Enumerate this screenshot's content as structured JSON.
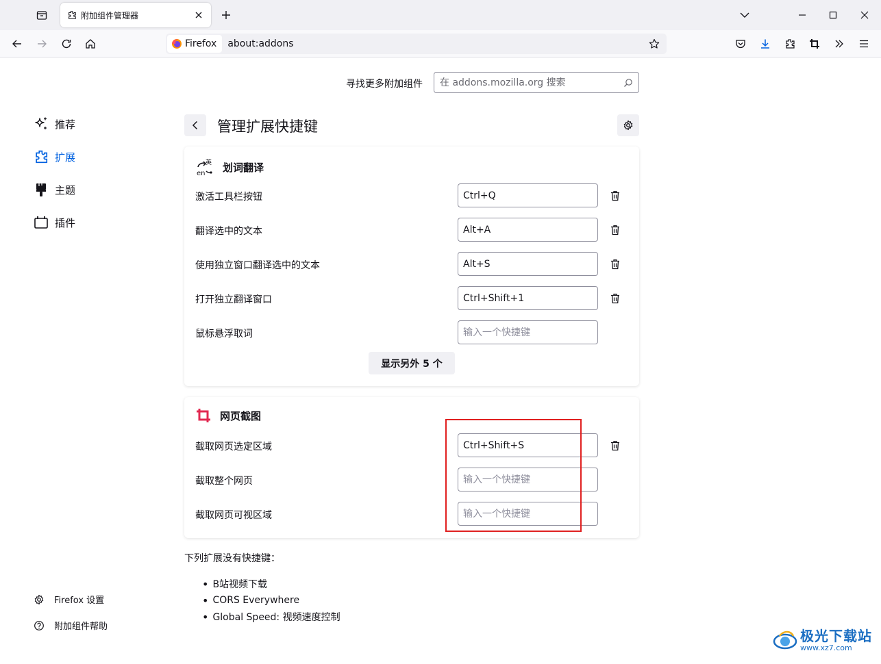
{
  "browser": {
    "tab_title": "附加组件管理器",
    "identity_label": "Firefox",
    "url": "about:addons"
  },
  "search": {
    "label": "寻找更多附加组件",
    "placeholder": "在 addons.mozilla.org 搜索"
  },
  "sidebar": {
    "items": [
      {
        "label": "推荐",
        "icon": "sparkle-icon"
      },
      {
        "label": "扩展",
        "icon": "puzzle-icon",
        "active": true
      },
      {
        "label": "主题",
        "icon": "brush-icon"
      },
      {
        "label": "插件",
        "icon": "plugin-icon"
      }
    ],
    "footer": [
      {
        "label": "Firefox 设置",
        "icon": "gear-icon"
      },
      {
        "label": "附加组件帮助",
        "icon": "help-icon"
      }
    ]
  },
  "page": {
    "title": "管理扩展快捷键"
  },
  "extensions": [
    {
      "name": "划词翻译",
      "shortcuts": [
        {
          "label": "激活工具栏按钮",
          "value": "Ctrl+Q"
        },
        {
          "label": "翻译选中的文本",
          "value": "Alt+A"
        },
        {
          "label": "使用独立窗口翻译选中的文本",
          "value": "Alt+S"
        },
        {
          "label": "打开独立翻译窗口",
          "value": "Ctrl+Shift+1"
        },
        {
          "label": "鼠标悬浮取词",
          "value": ""
        }
      ],
      "more_label": "显示另外 5 个"
    },
    {
      "name": "网页截图",
      "shortcuts": [
        {
          "label": "截取网页选定区域",
          "value": "Ctrl+Shift+S"
        },
        {
          "label": "截取整个网页",
          "value": ""
        },
        {
          "label": "截取网页可视区域",
          "value": ""
        }
      ]
    }
  ],
  "shortcut_placeholder": "输入一个快捷键",
  "no_shortcuts": {
    "title": "下列扩展没有快捷键：",
    "items": [
      "B站视频下载",
      "CORS Everywhere",
      "Global Speed: 视频速度控制"
    ]
  },
  "watermark": {
    "main": "极光下载站",
    "sub": "www.xz7.com"
  },
  "colors": {
    "accent": "#0061e0",
    "highlight": "#e02020",
    "screenshot_icon": "#e22850"
  }
}
